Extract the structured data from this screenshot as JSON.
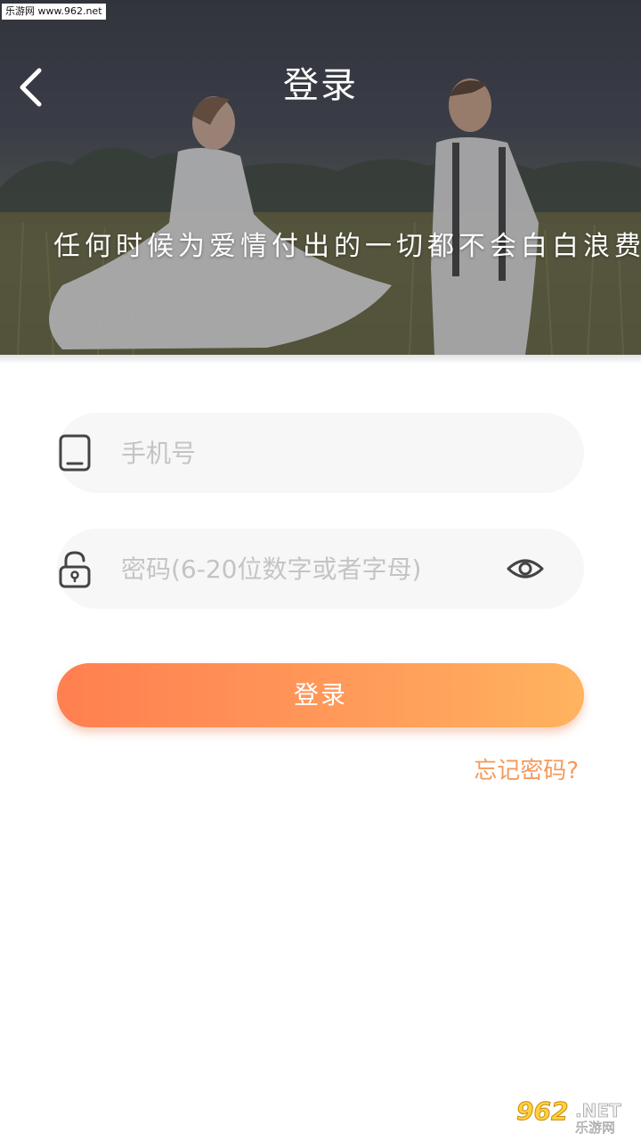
{
  "watermark_top": {
    "text": "乐游网 www.962.net"
  },
  "header": {
    "title": "登录",
    "back_icon": "chevron-left-icon",
    "slogan": "任何时候为爱情付出的一切都不会白白浪费"
  },
  "form": {
    "phone": {
      "icon": "tablet-icon",
      "placeholder": "手机号",
      "value": ""
    },
    "password": {
      "icon": "lock-icon",
      "placeholder": "密码(6-20位数字或者字母)",
      "value": "",
      "toggle_icon": "eye-icon"
    },
    "login_label": "登录",
    "forgot_label": "忘记密码?"
  },
  "watermark_bottom": {
    "number": "962",
    "net": ".NET",
    "cn": "乐游网"
  },
  "colors": {
    "accent_start": "#ff7f50",
    "accent_end": "#ffb35f",
    "link": "#f59a5c",
    "field_bg": "#f7f7f7",
    "placeholder": "#c4c4c4"
  }
}
